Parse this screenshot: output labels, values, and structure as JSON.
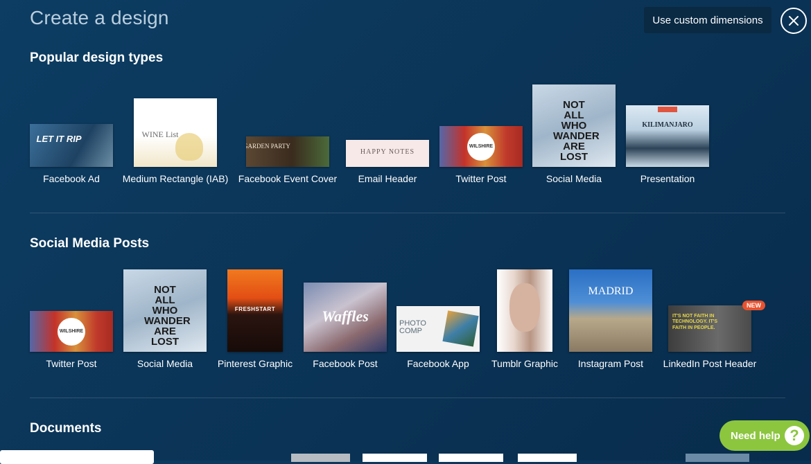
{
  "header": {
    "title": "Create a design",
    "custom_button": "Use custom dimensions"
  },
  "sections": {
    "popular": "Popular design types",
    "social": "Social Media Posts",
    "documents": "Documents"
  },
  "popular_items": [
    {
      "label": "Facebook Ad",
      "thumb_text": "LET IT RIP"
    },
    {
      "label": "Medium Rectangle (IAB)",
      "thumb_text": "WINE List"
    },
    {
      "label": "Facebook Event Cover",
      "thumb_text": "GARDEN PARTY"
    },
    {
      "label": "Email Header",
      "thumb_text": "HAPPY NOTES"
    },
    {
      "label": "Twitter Post",
      "thumb_text": "WILSHIRE"
    },
    {
      "label": "Social Media",
      "thumb_text": "NOT ALL WHO WANDER ARE LOST"
    },
    {
      "label": "Presentation",
      "thumb_text": "KILIMANJARO"
    }
  ],
  "social_items": [
    {
      "label": "Twitter Post",
      "thumb_text": "WILSHIRE"
    },
    {
      "label": "Social Media",
      "thumb_text": "NOT ALL WHO WANDER ARE LOST"
    },
    {
      "label": "Pinterest Graphic",
      "thumb_text": "FRESHSTART"
    },
    {
      "label": "Facebook Post",
      "thumb_text": "Waffles"
    },
    {
      "label": "Facebook App",
      "thumb_text": "PHOTO COMP"
    },
    {
      "label": "Tumblr Graphic",
      "thumb_text": ""
    },
    {
      "label": "Instagram Post",
      "thumb_text": "MADRID"
    },
    {
      "label": "LinkedIn Post Header",
      "thumb_text": "IT'S NOT FAITH IN TECHNOLOGY. IT'S FAITH IN PEOPLE.",
      "badge": "NEW"
    }
  ],
  "help": {
    "label": "Need help",
    "icon": "?"
  },
  "colors": {
    "background": "#0b3558",
    "help_green": "#8cc63f",
    "badge": "#e8522f"
  }
}
